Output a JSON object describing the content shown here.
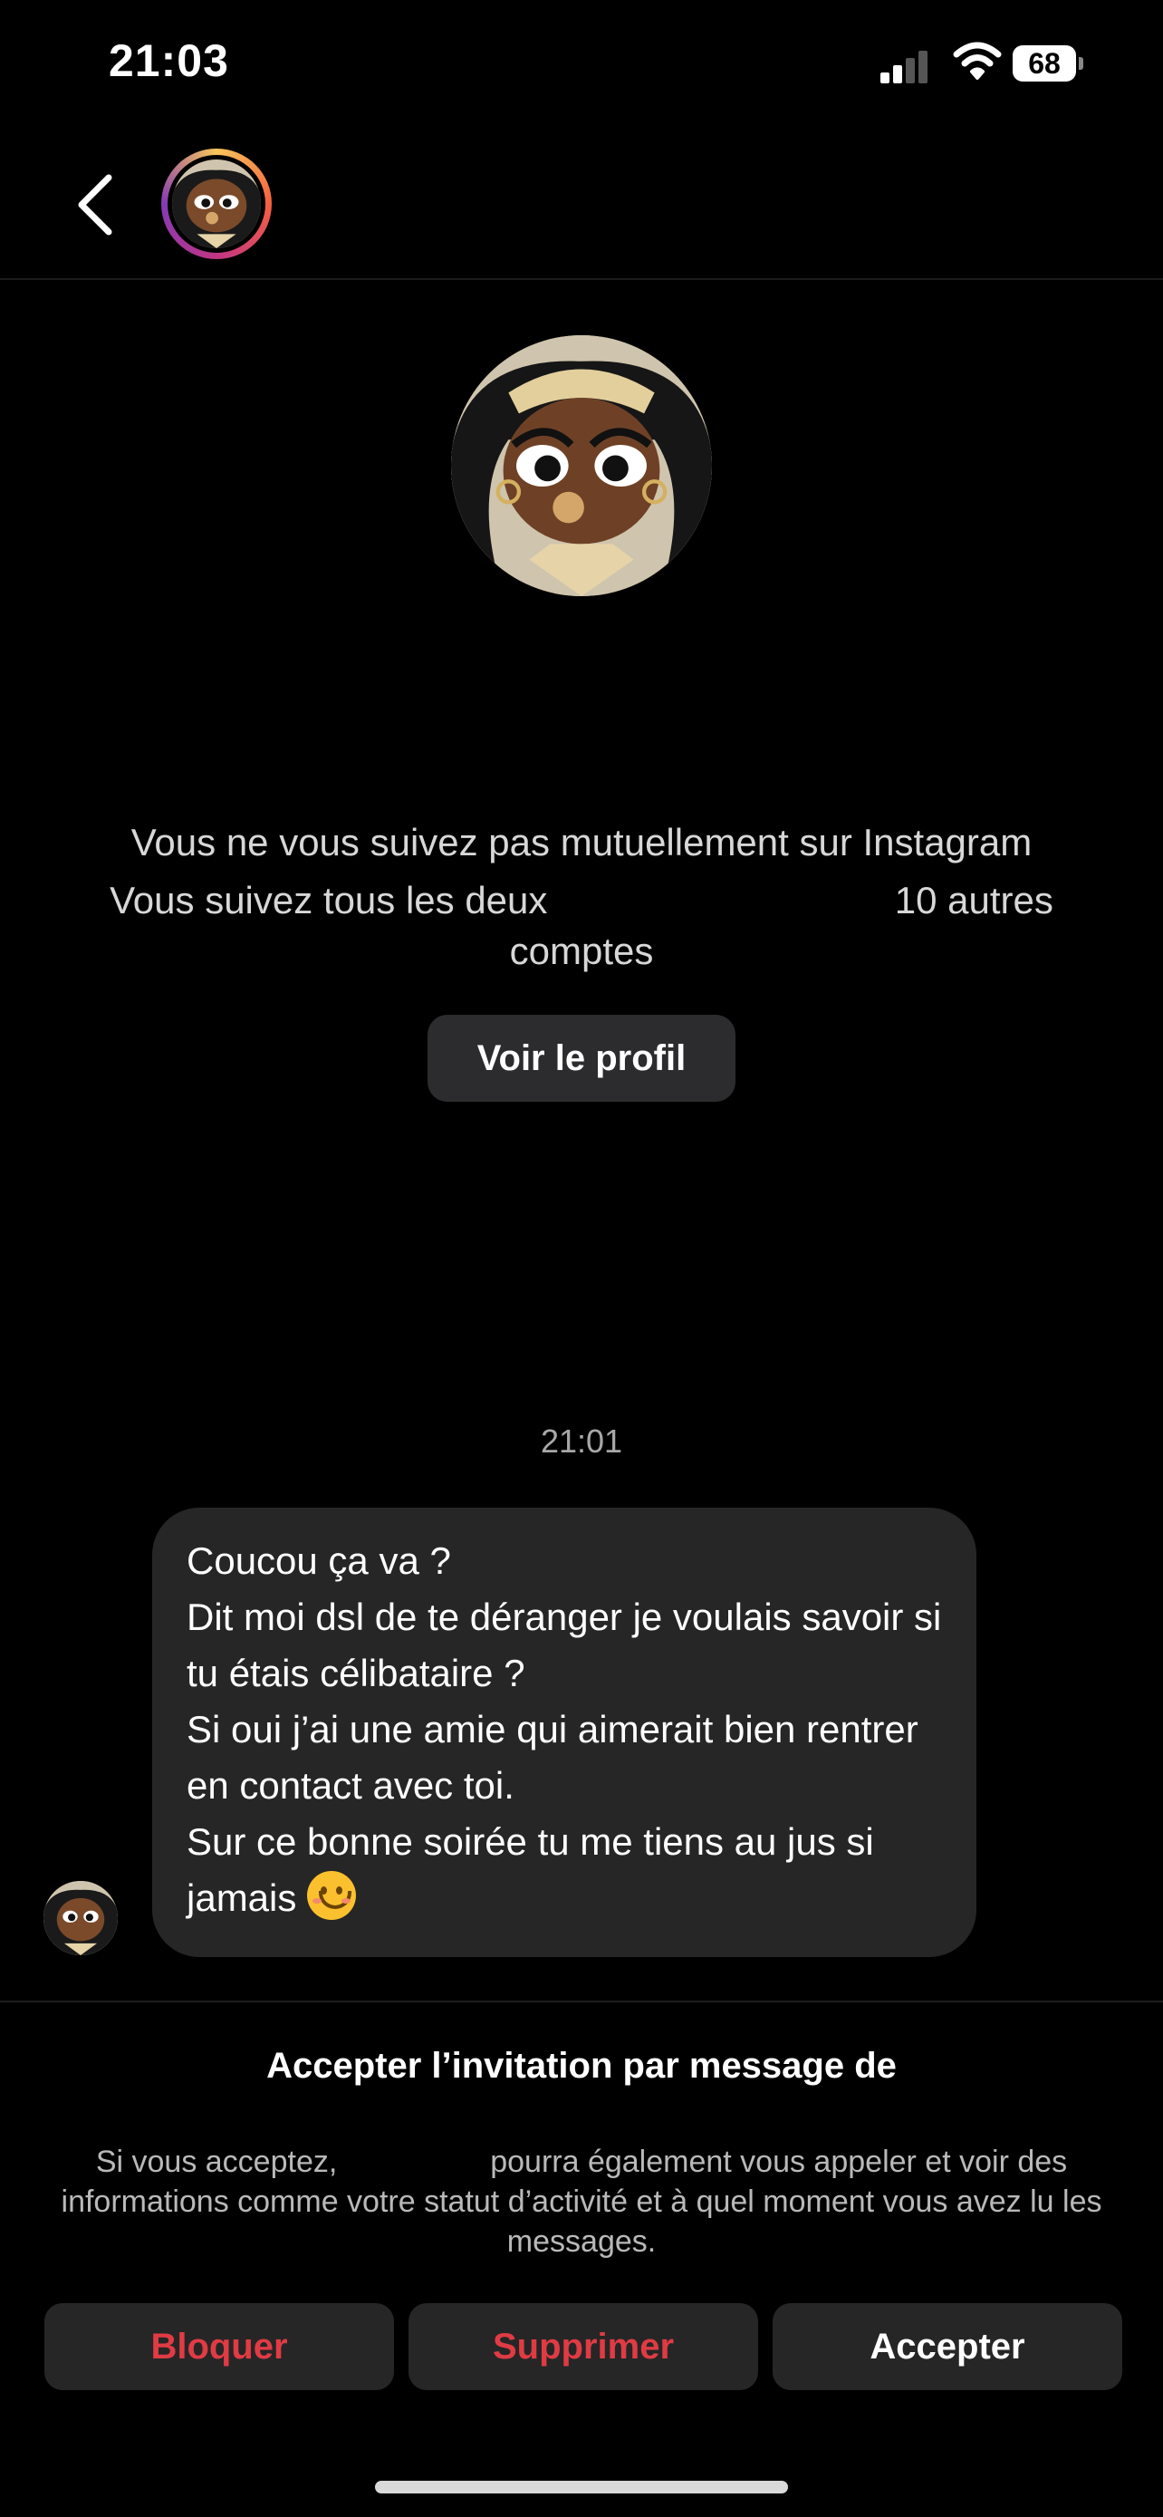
{
  "status_bar": {
    "time": "21:03",
    "battery": "68",
    "icons": [
      "signal-icon",
      "wifi-icon",
      "battery-icon"
    ]
  },
  "header": {
    "back_icon": "chevron-left-icon"
  },
  "profile": {
    "mutual_follow_text": "Vous ne vous suivez pas mutuellement sur Instagram",
    "common_follows_prefix": "Vous suivez tous les deux",
    "common_follows_suffix": "10 autres",
    "common_follows_end": "comptes",
    "view_profile_label": "Voir le profil"
  },
  "chat": {
    "timestamp": "21:01",
    "message_lines": [
      "Coucou ça va ?",
      "Dit moi dsl de te déranger je voulais savoir si tu étais célibataire ?",
      "Si oui j’ai une amie qui aimerait bien rentrer en contact avec toi.",
      "Sur ce bonne soirée tu me tiens au jus si jamais"
    ],
    "emoji": "smiling-face-icon"
  },
  "invitation": {
    "title": "Accepter l’invitation par message de",
    "description_start": "Si vous acceptez,",
    "description_mid": "pourra également vous appeler et voir des informations comme votre statut d’activité et à quel moment vous avez lu les messages.",
    "block_label": "Bloquer",
    "delete_label": "Supprimer",
    "accept_label": "Accepter",
    "colors": {
      "destructive": "#e03b44",
      "button_bg": "#262626"
    }
  }
}
